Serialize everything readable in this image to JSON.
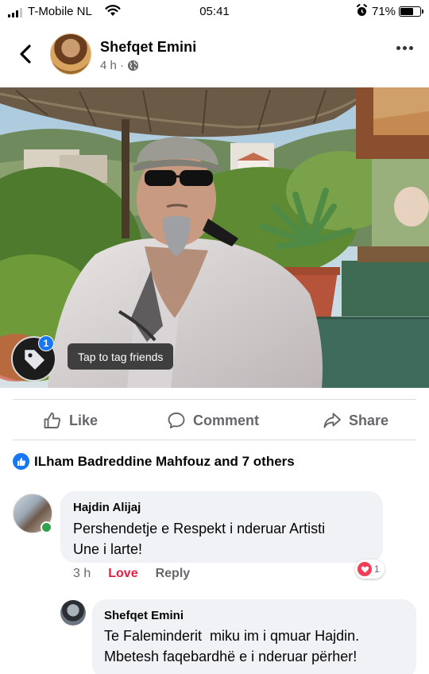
{
  "status_bar": {
    "carrier": "T-Mobile NL",
    "time": "05:41",
    "battery": "71%",
    "battery_level": 0.71
  },
  "post": {
    "author": "Shefqet Emini",
    "time_ago": "4 h ·",
    "privacy_icon": "globe-icon",
    "tag_count": "1",
    "tag_tooltip": "Tap to tag friends"
  },
  "actions": {
    "like": "Like",
    "comment": "Comment",
    "share": "Share"
  },
  "reactions": {
    "summary": "ILham Badreddine Mahfouz and 7 others",
    "icon": "like-reaction-icon",
    "color": "#1877f2"
  },
  "comments": [
    {
      "author": "Hajdin Alijaj",
      "text": "Pershendetje e Respekt i nderuar Artisti\nUne i larte!",
      "time": "3 h",
      "like_label": "Love",
      "reply_label": "Reply",
      "reaction_count": "1",
      "reaction_icon": "heart-icon",
      "online": true
    },
    {
      "author": "Shefqet Emini",
      "text": "Te Faleminderit  miku im i qmuar Hajdin.\nMbetesh faqebardhë e i nderuar përher!"
    }
  ]
}
